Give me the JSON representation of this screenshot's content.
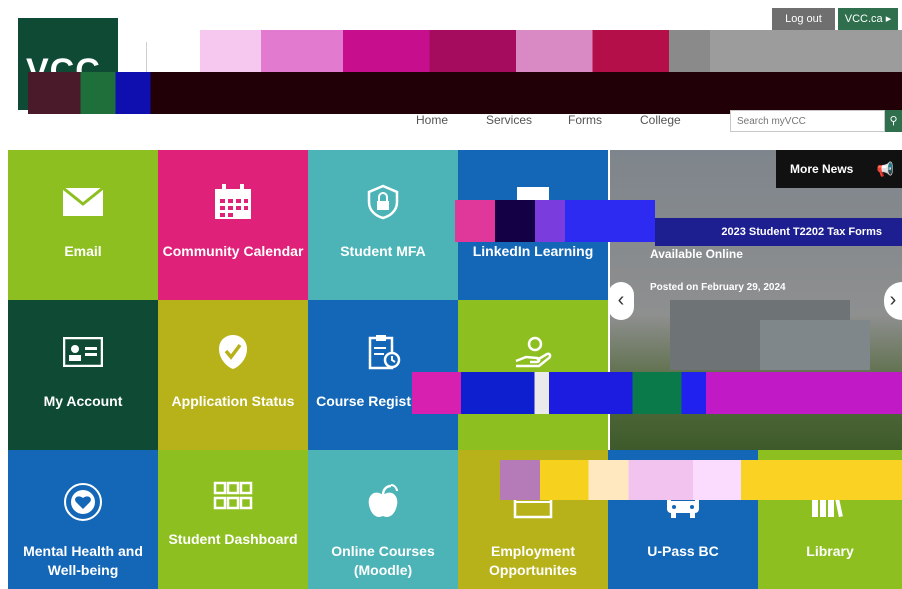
{
  "header": {
    "logo_text": "VCC",
    "logout_label": "Log out",
    "vccca_label": "VCC.ca ▸"
  },
  "nav": {
    "items": [
      "Home",
      "Services",
      "Forms",
      "College"
    ],
    "search_placeholder": "Search myVCC"
  },
  "colors": {
    "lime": "#8cbf1f",
    "pink": "#e0217a",
    "teal": "#4cb4b7",
    "blue": "#1467b6",
    "dark_green": "#0f4b34",
    "olive": "#b7b21a"
  },
  "tiles": [
    {
      "label": "Email",
      "icon": "envelope-icon",
      "color": "#8cbf1f"
    },
    {
      "label": "Community Calendar",
      "icon": "calendar-icon",
      "color": "#e0217a"
    },
    {
      "label": "Student MFA",
      "icon": "lock-icon",
      "color": "#4cb4b7"
    },
    {
      "label": "LinkedIn Learning",
      "icon": "presentation-icon",
      "color": "#1467b6"
    },
    {
      "label": "My Account",
      "icon": "id-card-icon",
      "color": "#0f4b34"
    },
    {
      "label": "Application Status",
      "icon": "checkmark-badge-icon",
      "color": "#b7b21a"
    },
    {
      "label": "Course Registration",
      "icon": "clipboard-clock-icon",
      "color": "#1467b6"
    },
    {
      "label": "",
      "icon": "hand-coin-icon",
      "color": "#8cbf1f"
    },
    {
      "label": "Mental Health and Well-being",
      "icon": "heart-seal-icon",
      "color": "#1467b6"
    },
    {
      "label": "Student Dashboard",
      "icon": "grid-icon",
      "color": "#8cbf1f"
    },
    {
      "label": "Online Courses (Moodle)",
      "icon": "apple-icon",
      "color": "#4cb4b7"
    },
    {
      "label": "Employment Opportunites",
      "icon": "briefcase-icon",
      "color": "#b7b21a"
    },
    {
      "label": "U-Pass BC",
      "icon": "bus-icon",
      "color": "#1467b6"
    },
    {
      "label": "Library",
      "icon": "books-icon",
      "color": "#8cbf1f"
    }
  ],
  "news": {
    "more_news_label": "More News",
    "tag": "2023 Student T2202 Tax Forms",
    "title": "Available Online",
    "date": "Posted on February 29, 2024",
    "prev_arrow": "‹",
    "next_arrow": "›"
  }
}
